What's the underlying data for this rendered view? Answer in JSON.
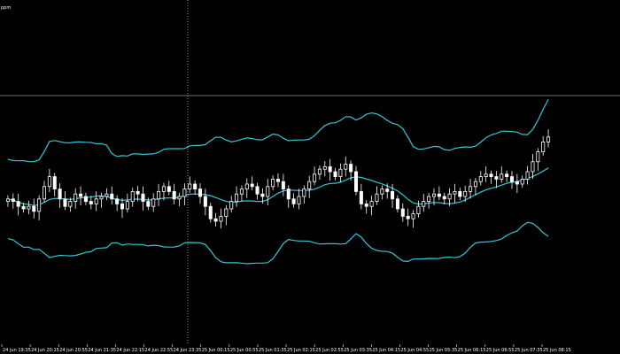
{
  "window": {
    "corner_label": "ppm",
    "background_color": "#000000",
    "candle_color": "#ffffff",
    "band_color": "#33c7d6",
    "crosshair_color": "#ffffff"
  },
  "chart_data": {
    "type": "candlestick",
    "title": "",
    "xlabel": "",
    "ylabel": "",
    "grid": false,
    "x_ticks": [
      "24 Jun 19:35",
      "24 Jun 20:15",
      "24 Jun 20:55",
      "24 Jun 21:35",
      "24 Jun 22:15",
      "24 Jun 22:55",
      "24 Jun 23:35",
      "25 Jun 00:15",
      "25 Jun 00:55",
      "25 Jun 01:35",
      "25 Jun 02:15",
      "25 Jun 02:55",
      "25 Jun 03:35",
      "25 Jun 04:15",
      "25 Jun 04:55",
      "25 Jun 05:35",
      "25 Jun 06:15",
      "25 Jun 06:55",
      "25 Jun 07:35",
      "25 Jun 08:15"
    ],
    "price_level_series": [
      -0.1,
      -0.2,
      -0.4,
      -0.5,
      -0.4,
      -0.6,
      -0.1,
      0.4,
      0.8,
      0.3,
      -0.1,
      -0.4,
      -0.2,
      0.1,
      0.0,
      -0.2,
      -0.3,
      -0.1,
      0.0,
      0.1,
      -0.1,
      -0.3,
      -0.5,
      -0.2,
      0.2,
      0.1,
      -0.2,
      -0.4,
      -0.1,
      0.2,
      0.4,
      0.2,
      -0.1,
      0.0,
      0.3,
      0.5,
      0.3,
      0.0,
      -0.4,
      -0.9,
      -1.0,
      -0.8,
      -0.5,
      -0.2,
      0.1,
      0.3,
      0.5,
      0.4,
      0.1,
      0.0,
      0.4,
      0.7,
      0.6,
      0.3,
      -0.1,
      -0.3,
      0.0,
      0.3,
      0.6,
      0.9,
      1.1,
      1.2,
      1.0,
      0.8,
      1.1,
      1.3,
      1.0,
      0.2,
      -0.3,
      -0.4,
      -0.2,
      0.1,
      0.3,
      0.2,
      -0.1,
      -0.5,
      -0.8,
      -0.9,
      -0.7,
      -0.4,
      -0.2,
      0.0,
      0.1,
      0.0,
      -0.1,
      0.1,
      0.2,
      0.0,
      0.2,
      0.4,
      0.6,
      0.8,
      0.9,
      0.8,
      0.7,
      0.9,
      0.8,
      0.6,
      0.5,
      0.7,
      1.0,
      1.4,
      1.8,
      2.2,
      2.4
    ]
  }
}
